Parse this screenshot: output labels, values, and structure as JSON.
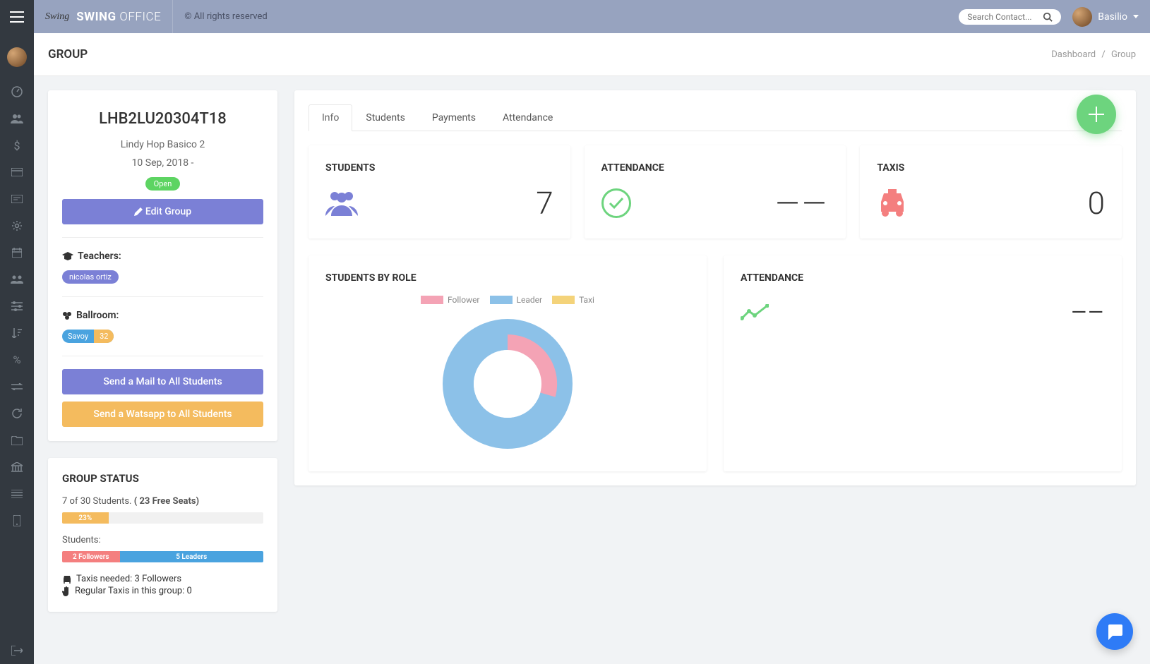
{
  "brand": {
    "script": "Swing",
    "bold": "SWING",
    "thin": "OFFICE"
  },
  "rights": "© All rights reserved",
  "search": {
    "placeholder": "Search Contact..."
  },
  "user": {
    "name": "Basilio"
  },
  "page": {
    "title": "GROUP",
    "breadcrumb": {
      "root": "Dashboard",
      "current": "Group"
    }
  },
  "group": {
    "code": "LHB2LU20304T18",
    "name": "Lindy Hop Basico 2",
    "date": "10 Sep, 2018 -",
    "status": "Open",
    "edit_label": "Edit Group",
    "teachers_label": "Teachers:",
    "teachers": [
      "nicolas ortiz"
    ],
    "ballroom_label": "Ballroom:",
    "ballroom": {
      "name": "Savoy",
      "cap": "32"
    },
    "mail_label": "Send a Mail to All Students",
    "whatsapp_label": "Send a Watsapp to All Students"
  },
  "group_status": {
    "title": "GROUP STATUS",
    "line1_pre": "7 of 30 Students. ",
    "line1_bold": "( 23 Free Seats)",
    "pct_label": "23%",
    "pct": 23,
    "students_label": "Students:",
    "followers": {
      "count": 2,
      "label": "2 Followers"
    },
    "leaders": {
      "count": 5,
      "label": "5 Leaders"
    },
    "taxis_needed": "Taxis needed: 3 Followers",
    "regular_taxis": "Regular Taxis in this group: 0"
  },
  "tabs": [
    {
      "label": "Info",
      "active": true
    },
    {
      "label": "Students",
      "active": false
    },
    {
      "label": "Payments",
      "active": false
    },
    {
      "label": "Attendance",
      "active": false
    }
  ],
  "stats": {
    "students": {
      "title": "STUDENTS",
      "value": "7"
    },
    "attendance": {
      "title": "ATTENDANCE",
      "value": "——"
    },
    "taxis": {
      "title": "TAXIS",
      "value": "0"
    }
  },
  "chart_role": {
    "title": "STUDENTS BY ROLE",
    "legend": [
      {
        "label": "Follower",
        "color": "#f4a3b5"
      },
      {
        "label": "Leader",
        "color": "#8cc1e8"
      },
      {
        "label": "Taxi",
        "color": "#f4d37a"
      }
    ]
  },
  "chart_attendance": {
    "title": "ATTENDANCE",
    "value": "——"
  },
  "chart_data": {
    "type": "pie",
    "title": "STUDENTS BY ROLE",
    "series": [
      {
        "name": "Follower",
        "value": 2,
        "color": "#f4a3b5"
      },
      {
        "name": "Leader",
        "value": 5,
        "color": "#8cc1e8"
      },
      {
        "name": "Taxi",
        "value": 0,
        "color": "#f4d37a"
      }
    ]
  }
}
